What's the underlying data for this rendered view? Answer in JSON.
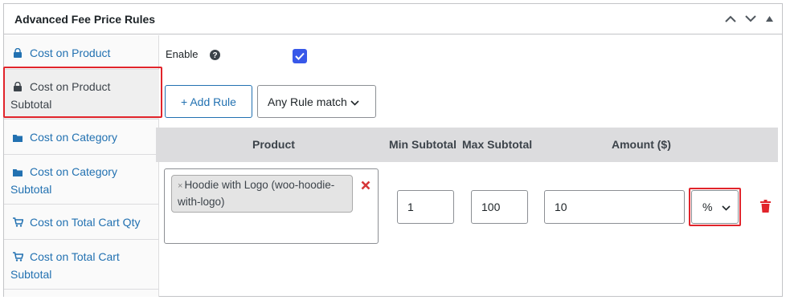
{
  "panel": {
    "title": "Advanced Fee Price Rules",
    "header_icons": [
      "chevron-up-icon",
      "chevron-down-icon",
      "triangle-up-icon"
    ]
  },
  "sidebar": {
    "items": [
      {
        "label": "Cost on Product",
        "icon": "basket-icon",
        "active": false
      },
      {
        "label": "Cost on Product Subtotal",
        "icon": "basket-icon",
        "active": true
      },
      {
        "label": "Cost on Category",
        "icon": "folder-icon",
        "active": false
      },
      {
        "label": "Cost on Category Subtotal",
        "icon": "folder-icon",
        "active": false
      },
      {
        "label": "Cost on Total Cart Qty",
        "icon": "cart-icon",
        "active": false
      },
      {
        "label": "Cost on Total Cart Subtotal",
        "icon": "cart-icon",
        "active": false
      }
    ]
  },
  "settings": {
    "enable_label": "Enable",
    "enable_checked": true
  },
  "toolbar": {
    "add_rule_label": "+ Add Rule",
    "match_select_value": "Any Rule match"
  },
  "table": {
    "headers": [
      "Product",
      "Min Subtotal",
      "Max Subtotal",
      "Amount ($)"
    ],
    "rows": [
      {
        "product_token": "Hoodie with Logo (woo-hoodie-with-logo)",
        "token_remove_glyph": "×",
        "min_subtotal": "1",
        "max_subtotal": "100",
        "amount": "10",
        "amount_type": "%"
      }
    ]
  },
  "colors": {
    "link_blue": "#2271b1",
    "checkbox_blue": "#3858e9",
    "highlight_red": "#e1242b",
    "delete_red": "#d63638",
    "table_header_bg": "#dcdcde"
  }
}
